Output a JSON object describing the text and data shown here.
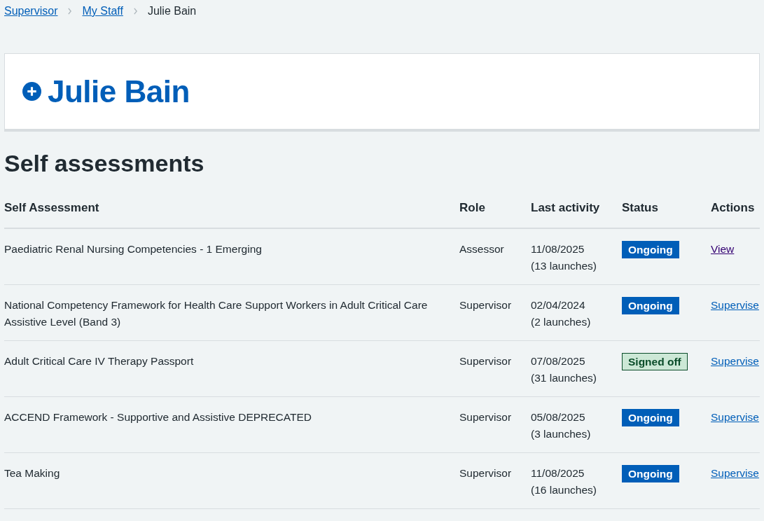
{
  "breadcrumbs": [
    {
      "label": "Supervisor",
      "kind": "link"
    },
    {
      "label": "My Staff",
      "kind": "link"
    },
    {
      "label": "Julie Bain",
      "kind": "current"
    }
  ],
  "header": {
    "name": "Julie Bain",
    "expanded": false
  },
  "section_title": "Self assessments",
  "table": {
    "columns": [
      "Self Assessment",
      "Role",
      "Last activity",
      "Status",
      "Actions"
    ],
    "rows": [
      {
        "name": "Paediatric Renal Nursing Competencies - 1 Emerging",
        "role": "Assessor",
        "date": "11/08/2025",
        "launches": "(13 launches)",
        "status": {
          "label": "Ongoing",
          "kind": "ongoing"
        },
        "action": {
          "label": "View",
          "visited": true
        }
      },
      {
        "name": "National Competency Framework for Health Care Support Workers in Adult Critical Care Assistive Level (Band 3)",
        "role": "Supervisor",
        "date": "02/04/2024",
        "launches": "(2 launches)",
        "status": {
          "label": "Ongoing",
          "kind": "ongoing"
        },
        "action": {
          "label": "Supervise",
          "visited": false
        }
      },
      {
        "name": "Adult Critical Care IV Therapy Passport",
        "role": "Supervisor",
        "date": "07/08/2025",
        "launches": "(31 launches)",
        "status": {
          "label": "Signed off",
          "kind": "signed_off"
        },
        "action": {
          "label": "Supervise",
          "visited": false
        }
      },
      {
        "name": "ACCEND Framework - Supportive and Assistive DEPRECATED",
        "role": "Supervisor",
        "date": "05/08/2025",
        "launches": "(3 launches)",
        "status": {
          "label": "Ongoing",
          "kind": "ongoing"
        },
        "action": {
          "label": "Supervise",
          "visited": false
        }
      },
      {
        "name": "Tea Making",
        "role": "Supervisor",
        "date": "11/08/2025",
        "launches": "(16 launches)",
        "status": {
          "label": "Ongoing",
          "kind": "ongoing"
        },
        "action": {
          "label": "Supervise",
          "visited": false
        }
      }
    ]
  }
}
